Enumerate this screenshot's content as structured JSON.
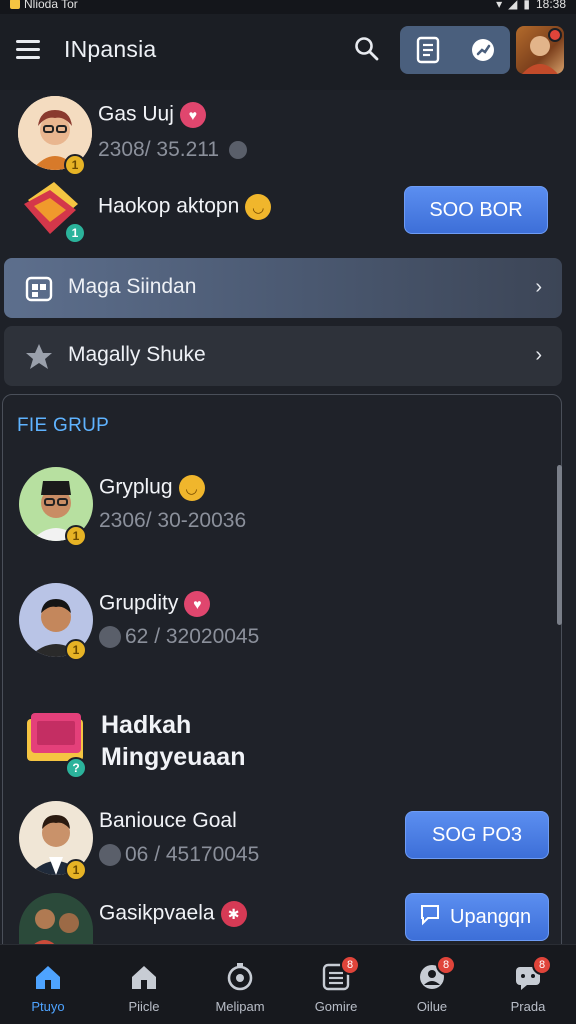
{
  "status_bar": {
    "left_text": "Nlioda Tor",
    "time": "18:38"
  },
  "app_bar": {
    "title": "INpansia"
  },
  "contacts_top": [
    {
      "name": "Gas Uuj",
      "sub": "2308/ 35.211"
    },
    {
      "name": "Haokop aktopn",
      "button_label": "SOO BOR"
    }
  ],
  "menu": [
    {
      "label": "Maga Siindan"
    },
    {
      "label": "Magally Shuke"
    }
  ],
  "group": {
    "title": "FIE GRUP",
    "items": [
      {
        "name": "Gryplug",
        "sub": "2306/ 30-20036"
      },
      {
        "name": "Grupdity",
        "sub": "62 / 32020045"
      },
      {
        "name_line1": "Hadkah",
        "name_line2": "Mingyeuaan"
      },
      {
        "name": "Baniouce Goal",
        "sub": "06 / 45170045",
        "button_label": "SOG PO3"
      },
      {
        "name": "Gasikpvaela",
        "button_label": "Upangqn"
      }
    ]
  },
  "bottom_nav": [
    {
      "label": "Ptuyo",
      "icon": "home-icon"
    },
    {
      "label": "Piicle",
      "icon": "house-icon"
    },
    {
      "label": "Melipam",
      "icon": "timer-icon"
    },
    {
      "label": "Gomire",
      "icon": "grid-icon",
      "badge": "8"
    },
    {
      "label": "Oilue",
      "icon": "profile-icon",
      "badge": "8"
    },
    {
      "label": "Prada",
      "icon": "chat-icon",
      "badge": "8"
    }
  ],
  "colors": {
    "accent": "#4ea3ff",
    "button": "#4a7fe6",
    "background": "#1e2128"
  }
}
